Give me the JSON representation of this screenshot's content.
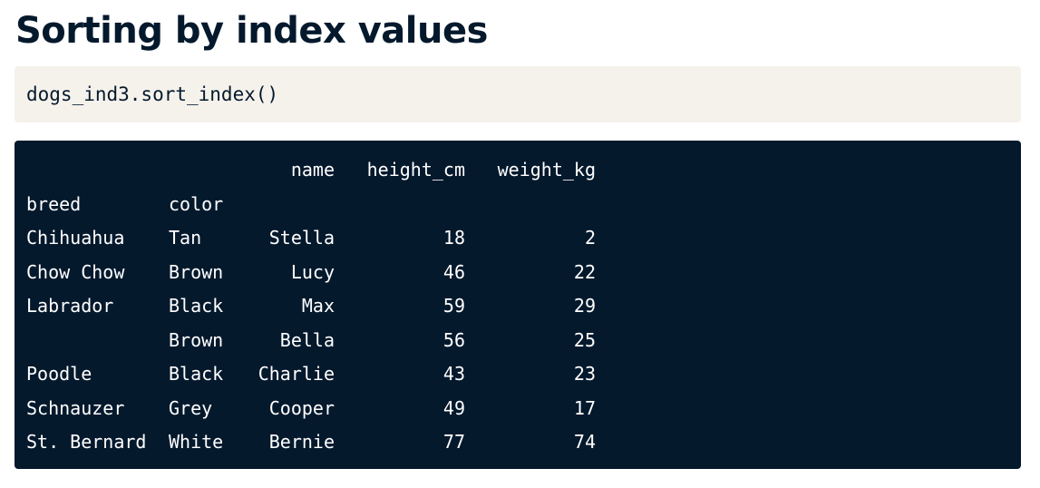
{
  "slide": {
    "title": "Sorting by index values"
  },
  "code": {
    "text": "dogs_ind3.sort_index()"
  },
  "output": {
    "columns": [
      "name",
      "height_cm",
      "weight_kg"
    ],
    "index_names": [
      "breed",
      "color"
    ],
    "rows": [
      {
        "breed": "Chihuahua",
        "color": "Tan",
        "name": "Stella",
        "height_cm": "18",
        "weight_kg": "2"
      },
      {
        "breed": "Chow Chow",
        "color": "Brown",
        "name": "Lucy",
        "height_cm": "46",
        "weight_kg": "22"
      },
      {
        "breed": "Labrador",
        "color": "Black",
        "name": "Max",
        "height_cm": "59",
        "weight_kg": "29"
      },
      {
        "breed": "",
        "color": "Brown",
        "name": "Bella",
        "height_cm": "56",
        "weight_kg": "25"
      },
      {
        "breed": "Poodle",
        "color": "Black",
        "name": "Charlie",
        "height_cm": "43",
        "weight_kg": "23"
      },
      {
        "breed": "Schnauzer",
        "color": "Grey",
        "name": "Cooper",
        "height_cm": "49",
        "weight_kg": "17"
      },
      {
        "breed": "St. Bernard",
        "color": "White",
        "name": "Bernie",
        "height_cm": "77",
        "weight_kg": "74"
      }
    ]
  },
  "colors": {
    "title_text": "#05192d",
    "code_background": "#f5f2eb",
    "output_background": "#05192d",
    "output_text": "#ffffff"
  }
}
